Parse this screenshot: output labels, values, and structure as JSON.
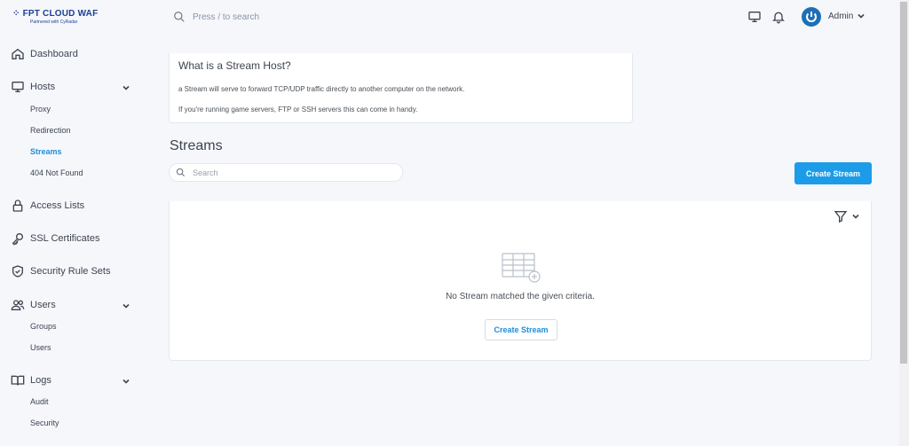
{
  "brand": {
    "name": "FPT CLOUD  WAF",
    "tagline": "Partnered with CyRadar"
  },
  "header": {
    "search_placeholder": "Press / to search",
    "user_name": "Admin"
  },
  "sidebar": {
    "dashboard": "Dashboard",
    "hosts": "Hosts",
    "hosts_sub": [
      "Proxy",
      "Redirection",
      "Streams",
      "404 Not Found"
    ],
    "access_lists": "Access Lists",
    "ssl": "SSL Certificates",
    "security_rules": "Security Rule Sets",
    "users": "Users",
    "users_sub": [
      "Groups",
      "Users"
    ],
    "logs": "Logs",
    "logs_sub": [
      "Audit",
      "Security"
    ],
    "active_item": "Streams"
  },
  "info": {
    "title": "What is a Stream Host?",
    "line1": "a Stream will serve to forward TCP/UDP traffic directly to another computer on the network.",
    "line2": "If you're running game servers, FTP or SSH servers this can come in handy."
  },
  "main": {
    "title": "Streams",
    "search_placeholder": "Search",
    "create_label": "Create Stream",
    "empty_text": "No Stream matched the given criteria.",
    "empty_create_label": "Create Stream"
  },
  "colors": {
    "accent": "#1c9ce8",
    "active_link": "#1c8fd9",
    "brand": "#1c3f94"
  },
  "icons": {
    "search": "search-icon",
    "monitor": "monitor-icon",
    "bell": "bell-icon",
    "power": "power-icon",
    "filter": "filter-icon",
    "empty": "empty-table-icon"
  }
}
